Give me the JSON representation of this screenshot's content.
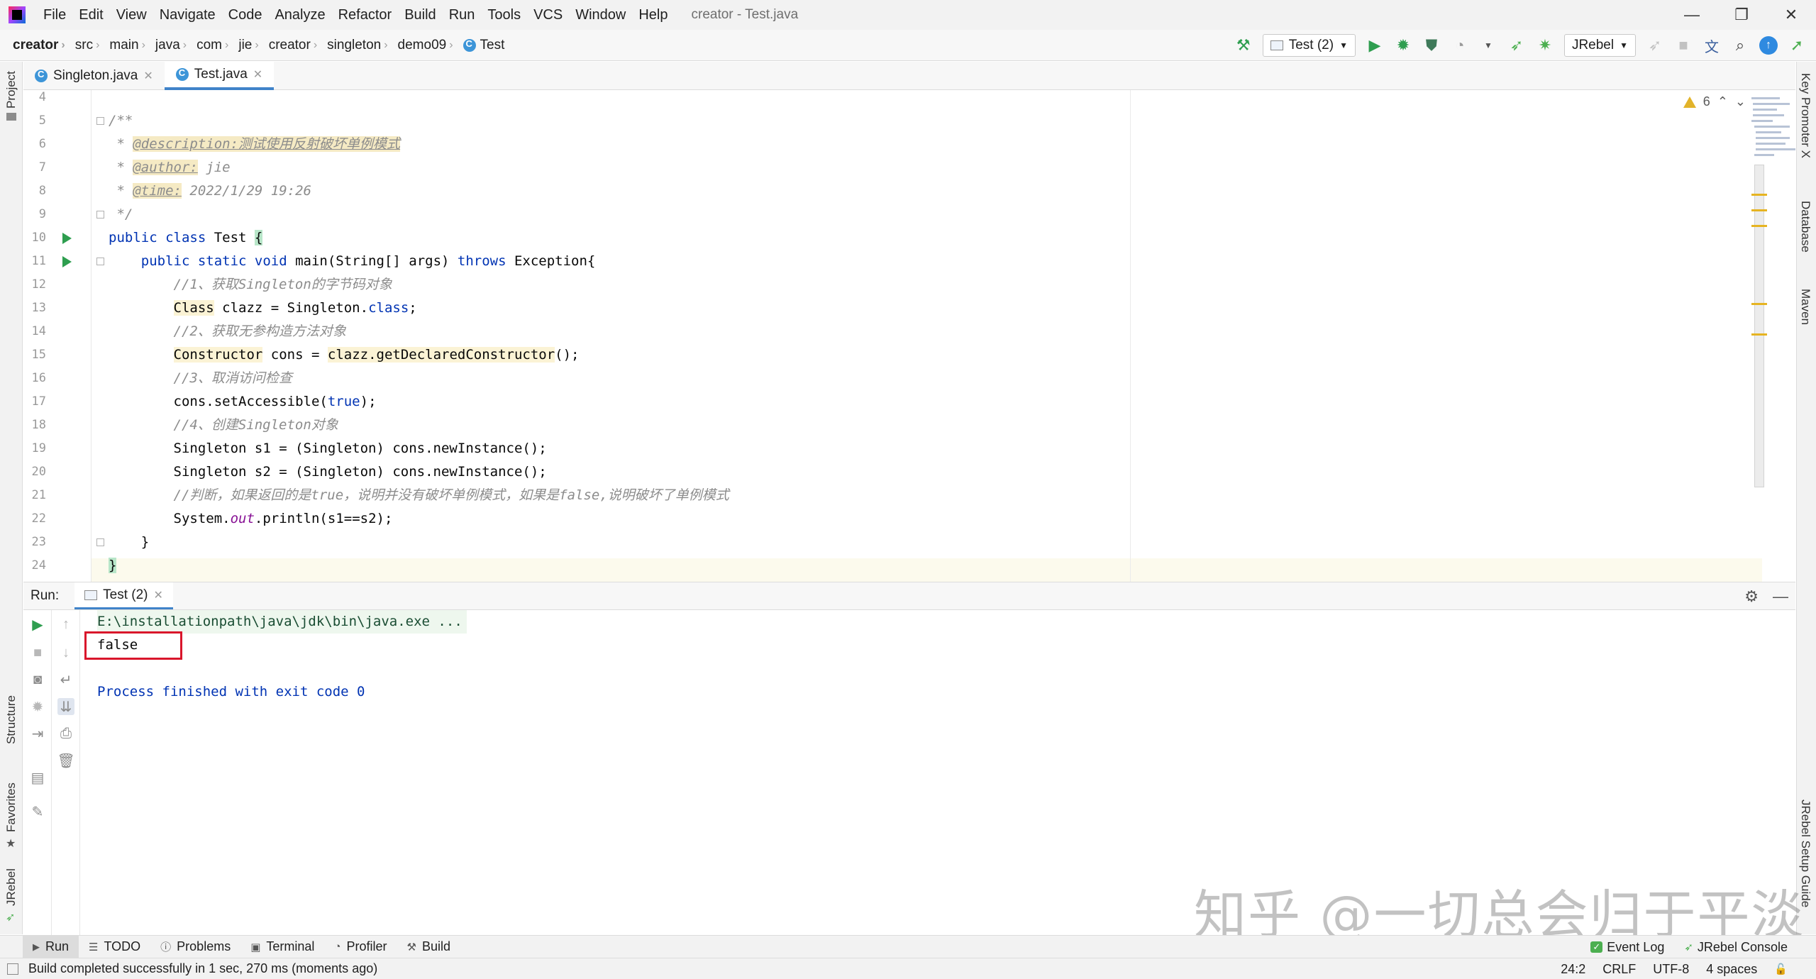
{
  "window": {
    "title": "creator - Test.java",
    "minimize": "—",
    "restore": "❐",
    "close": "✕"
  },
  "menu": [
    "File",
    "Edit",
    "View",
    "Navigate",
    "Code",
    "Analyze",
    "Refactor",
    "Build",
    "Run",
    "Tools",
    "VCS",
    "Window",
    "Help"
  ],
  "breadcrumb": [
    "creator",
    "src",
    "main",
    "java",
    "com",
    "jie",
    "creator",
    "singleton",
    "demo09",
    "Test"
  ],
  "toolbar": {
    "run_config": "Test (2)",
    "jrebel": "JRebel"
  },
  "editor_tabs": [
    {
      "label": "Singleton.java",
      "active": false
    },
    {
      "label": "Test.java",
      "active": true
    }
  ],
  "inspection": {
    "warnings": "6"
  },
  "line_numbers": [
    "4",
    "5",
    "6",
    "7",
    "8",
    "9",
    "10",
    "11",
    "12",
    "13",
    "14",
    "15",
    "16",
    "17",
    "18",
    "19",
    "20",
    "21",
    "22",
    "23",
    "24"
  ],
  "code": {
    "l5": "/**",
    "l6_star": " * ",
    "l6_tag": "@description:测试使用反射破坏单例模式",
    "l7_star": " * ",
    "l7_tag": "@author:",
    "l7_val": " jie",
    "l8_star": " * ",
    "l8_tag": "@time:",
    "l8_val": " 2022/1/29 19:26",
    "l9": " */",
    "l10_kw": "public class",
    "l10_name": " Test ",
    "l10_brace": "{",
    "l11_kw1": "    public static void",
    "l11_m": " main(String[] args) ",
    "l11_kw2": "throws",
    "l11_rest": " Exception{",
    "l12": "        //1、获取Singleton的字节码对象",
    "l13_indent": "        ",
    "l13_class": "Class",
    "l13_mid": " clazz = Singleton.",
    "l13_kw": "class",
    "l13_end": ";",
    "l14": "        //2、获取无参构造方法对象",
    "l15_indent": "        ",
    "l15_type": "Constructor",
    "l15_mid": " cons = ",
    "l15_call": "clazz.getDeclaredConstructor",
    "l15_end": "();",
    "l16": "        //3、取消访问检查",
    "l17_a": "        cons.setAccessible(",
    "l17_kw": "true",
    "l17_b": ");",
    "l18": "        //4、创建Singleton对象",
    "l19": "        Singleton s1 = (Singleton) cons.newInstance();",
    "l20": "        Singleton s2 = (Singleton) cons.newInstance();",
    "l21": "        //判断，如果返回的是true，说明并没有破坏单例模式，如果是false,说明破坏了单例模式",
    "l22_a": "        System.",
    "l22_fld": "out",
    "l22_b": ".println(s1==s2);",
    "l23": "    }",
    "l24": "}"
  },
  "run_panel": {
    "label": "Run:",
    "tab": "Test (2)",
    "console": {
      "cmd": "E:\\installationpath\\java\\jdk\\bin\\java.exe ...",
      "output": "false",
      "exit": "Process finished with exit code 0"
    }
  },
  "watermark": "知乎 @一切总会归于平淡",
  "side_tabs": {
    "project": "Project",
    "structure": "Structure",
    "favorites": "Favorites",
    "jrebel": "JRebel",
    "key_promoter": "Key Promoter X",
    "database": "Database",
    "maven": "Maven",
    "jrebel_setup": "JRebel Setup Guide"
  },
  "bottom_tabs": [
    "Run",
    "TODO",
    "Problems",
    "Terminal",
    "Profiler",
    "Build"
  ],
  "bottom_right": {
    "event_log": "Event Log",
    "jrebel_console": "JRebel Console"
  },
  "status": {
    "message": "Build completed successfully in 1 sec, 270 ms (moments ago)",
    "position": "24:2",
    "line_sep": "CRLF",
    "encoding": "UTF-8",
    "indent": "4 spaces"
  },
  "colors": {
    "accent": "#4083c9",
    "run_green": "#2e9e4f",
    "highlight_red": "#d9162b",
    "keyword": "#0033b3",
    "warning": "#e2b32a"
  }
}
